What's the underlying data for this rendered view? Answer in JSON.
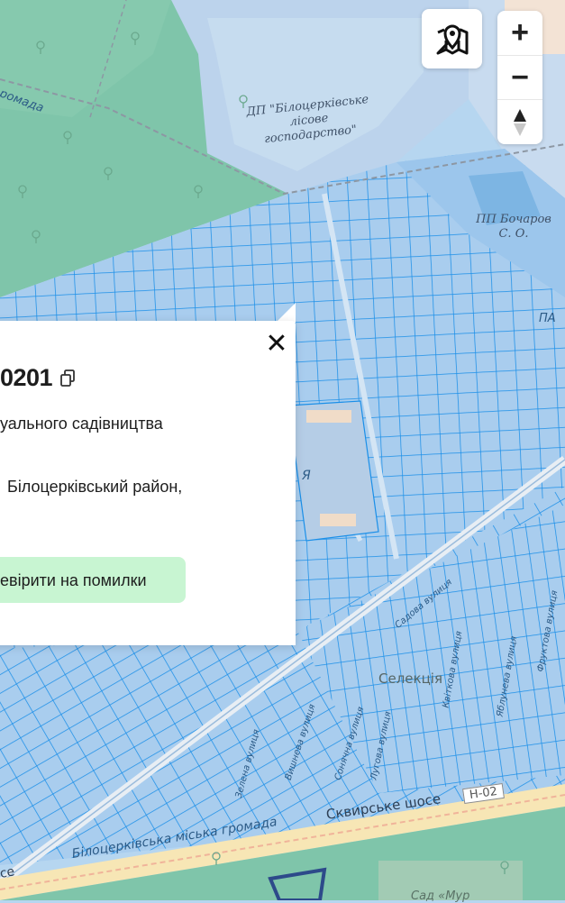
{
  "map": {
    "labels": {
      "forestry_enterprise": [
        "ДП \"Білоцерківське",
        "лісове",
        "господарство\""
      ],
      "private_enterprise": [
        "ПП Бочаров",
        "С. О."
      ],
      "community_partial": "ромада",
      "partial_pa": "ПА",
      "partial_ya": "Я",
      "skvyrske_shose": "Сквирське шосе",
      "city_community": "Білоцерківська міська громада",
      "road_shield": "Н-02",
      "seleksiia": "Селекція",
      "garden": "Сад «Мур",
      "partial_ce": "се",
      "street_1": "Садова вулиця",
      "street_2": "Сонячна вулиця",
      "street_3": "Квіткова вулиця",
      "street_4": "Вишнева вулиця",
      "street_5": "Зелена вулиця",
      "street_6": "Лугова вулиця",
      "street_7": "Фруктова вулиця",
      "street_8": "Яблунева вулиця"
    }
  },
  "controls": {
    "layers_icon": "map-pin-layers-icon",
    "zoom_in": "+",
    "zoom_out": "−",
    "compass": "▲▼"
  },
  "popup": {
    "close": "✕",
    "cadastral_number": "0201",
    "purpose": "уального садівництва",
    "address": "Білоцерківський район,",
    "check_button": "евірити на помилки"
  },
  "colors": {
    "water_blue": "#b6d6f0",
    "forest_green": "#7fc5aa",
    "parcel_stroke": "#1a8fe6",
    "button_green": "#c8f5d2"
  }
}
